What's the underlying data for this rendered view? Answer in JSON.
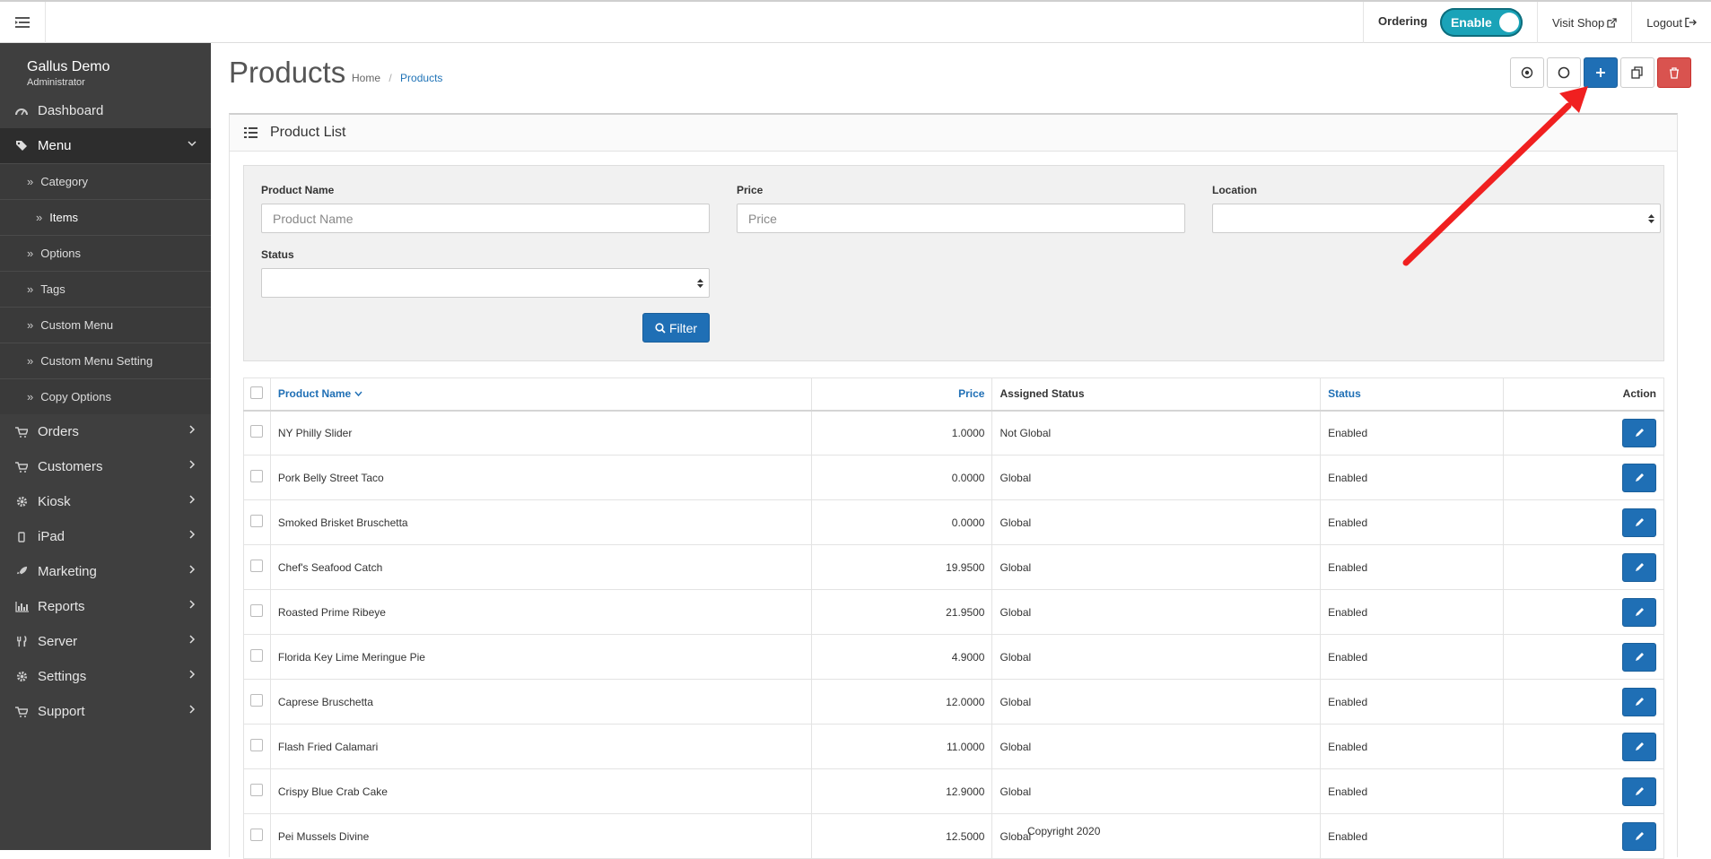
{
  "header": {
    "ordering_label": "Ordering",
    "toggle_label": "Enable",
    "visit_shop": "Visit Shop",
    "logout": "Logout"
  },
  "sidebar": {
    "user_name": "Gallus Demo",
    "user_role": "Administrator",
    "items": [
      {
        "label": "Dashboard",
        "icon": "dashboard-icon"
      },
      {
        "label": "Menu",
        "icon": "tags-icon"
      },
      {
        "label": "Orders",
        "icon": "cart-icon"
      },
      {
        "label": "Customers",
        "icon": "cart-icon"
      },
      {
        "label": "Kiosk",
        "icon": "gear-icon"
      },
      {
        "label": "iPad",
        "icon": "tablet-icon"
      },
      {
        "label": "Marketing",
        "icon": "rocket-icon"
      },
      {
        "label": "Reports",
        "icon": "bar-chart-icon"
      },
      {
        "label": "Server",
        "icon": "utensils-icon"
      },
      {
        "label": "Settings",
        "icon": "gear-icon"
      },
      {
        "label": "Support",
        "icon": "cart-icon"
      }
    ],
    "menu_sub": [
      "Category",
      "Items",
      "Options",
      "Tags",
      "Custom Menu",
      "Custom Menu Setting",
      "Copy Options"
    ]
  },
  "page": {
    "title": "Products",
    "breadcrumb_home": "Home",
    "breadcrumb_sep": "/",
    "breadcrumb_current": "Products"
  },
  "panel": {
    "title": "Product List"
  },
  "filter": {
    "name_label": "Product Name",
    "name_placeholder": "Product Name",
    "price_label": "Price",
    "price_placeholder": "Price",
    "location_label": "Location",
    "status_label": "Status",
    "button": "Filter"
  },
  "table": {
    "headers": {
      "name": "Product Name",
      "price": "Price",
      "assigned": "Assigned Status",
      "status": "Status",
      "action": "Action"
    },
    "rows": [
      {
        "name": "NY Philly Slider",
        "price": "1.0000",
        "assigned": "Not Global",
        "status": "Enabled"
      },
      {
        "name": "Pork Belly Street Taco",
        "price": "0.0000",
        "assigned": "Global",
        "status": "Enabled"
      },
      {
        "name": "Smoked Brisket Bruschetta",
        "price": "0.0000",
        "assigned": "Global",
        "status": "Enabled"
      },
      {
        "name": "Chef's Seafood Catch",
        "price": "19.9500",
        "assigned": "Global",
        "status": "Enabled"
      },
      {
        "name": "Roasted Prime Ribeye",
        "price": "21.9500",
        "assigned": "Global",
        "status": "Enabled"
      },
      {
        "name": "Florida Key Lime Meringue Pie",
        "price": "4.9000",
        "assigned": "Global",
        "status": "Enabled"
      },
      {
        "name": "Caprese Bruschetta",
        "price": "12.0000",
        "assigned": "Global",
        "status": "Enabled"
      },
      {
        "name": "Flash Fried Calamari",
        "price": "11.0000",
        "assigned": "Global",
        "status": "Enabled"
      },
      {
        "name": "Crispy Blue Crab Cake",
        "price": "12.9000",
        "assigned": "Global",
        "status": "Enabled"
      },
      {
        "name": "Pei Mussels Divine",
        "price": "12.5000",
        "assigned": "Global",
        "status": "Enabled"
      }
    ]
  },
  "footer": {
    "copyright": "Copyright 2020"
  },
  "colors": {
    "primary": "#1f6fb5",
    "danger": "#d9534f",
    "toggle": "#1aa3b8",
    "sidebar": "#3f3f3f",
    "annotation": "#f02020"
  }
}
